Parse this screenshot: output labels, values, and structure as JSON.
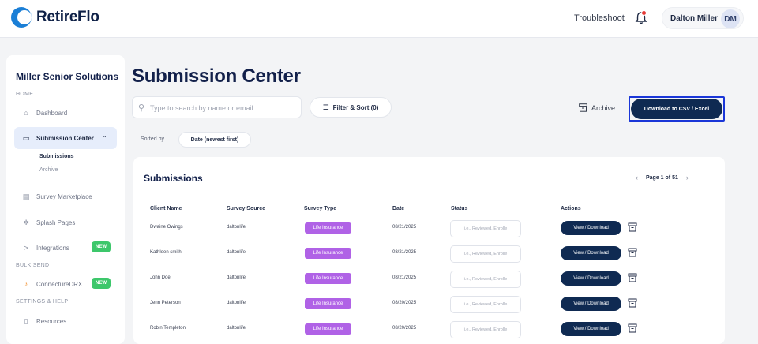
{
  "app": {
    "name": "RetireFlo"
  },
  "topbar": {
    "troubleshoot": "Troubleshoot",
    "user_name": "Dalton Miller",
    "user_initials": "DM"
  },
  "sidebar": {
    "org": "Miller Senior Solutions",
    "sections": {
      "home": "HOME",
      "bulk": "BULK SEND",
      "settings": "SETTINGS & HELP"
    },
    "items": {
      "dashboard": "Dashboard",
      "submission_center": "Submission Center",
      "submissions": "Submissions",
      "archive": "Archive",
      "survey_marketplace": "Survey Marketplace",
      "splash_pages": "Splash Pages",
      "integrations": "Integrations",
      "connecture": "ConnectureDRX",
      "resources": "Resources"
    },
    "badge": "NEW"
  },
  "main": {
    "title": "Submission Center",
    "search_placeholder": "Type to search by name or email",
    "filter_label": "Filter & Sort (0)",
    "archive_label": "Archive",
    "download_label": "Download to CSV / Excel",
    "sorted_by_label": "Sorted by",
    "sorted_by_value": "Date (newest first)"
  },
  "table": {
    "title": "Submissions",
    "page": "Page 1 of 51",
    "headers": [
      "Client Name",
      "Survey Source",
      "Survey Type",
      "Date",
      "Status",
      "Actions"
    ],
    "status_placeholder": "i.e., Reviewed, Enrolle",
    "view_label": "View / Download",
    "rows": [
      {
        "name": "Dwaine Owings",
        "source": "daltonlife",
        "type": "Life Insurance",
        "date": "08/21/2025"
      },
      {
        "name": "Kathleen smith",
        "source": "daltonlife",
        "type": "Life Insurance",
        "date": "08/21/2025"
      },
      {
        "name": "John Doe",
        "source": "daltonlife",
        "type": "Life Insurance",
        "date": "08/21/2025"
      },
      {
        "name": "Jenn Peterson",
        "source": "daltonlife",
        "type": "Life Insurance",
        "date": "08/20/2025"
      },
      {
        "name": "Robin Templeton",
        "source": "daltonlife",
        "type": "Life Insurance",
        "date": "08/20/2025"
      }
    ]
  }
}
